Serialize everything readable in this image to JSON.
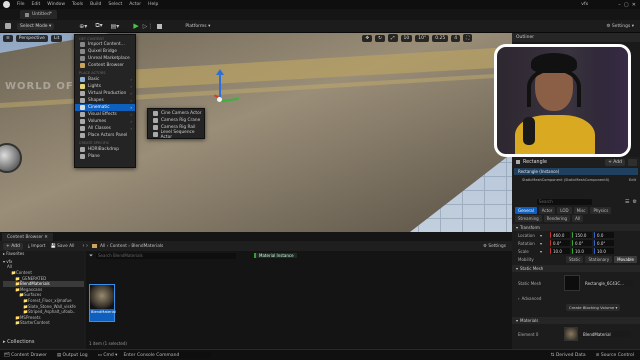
{
  "menubar": {
    "items": [
      "File",
      "Edit",
      "Window",
      "Tools",
      "Build",
      "Select",
      "Actor",
      "Help"
    ],
    "user": "vfx"
  },
  "tabs": {
    "project": "Untitled*"
  },
  "toolbar": {
    "select_mode": "Select Mode",
    "platforms": "Platforms",
    "settings": "Settings"
  },
  "viewport": {
    "perspective": "Perspective",
    "lit": "Lit",
    "watermark": "WORLD OF",
    "grid_value": "10",
    "angle_value": "10°",
    "scale_value": "0.25",
    "cam_speed": "4"
  },
  "add_menu": {
    "top_items": [
      "Import Content...",
      "Quixel Bridge",
      "Unreal Marketplace",
      "Content Browser"
    ],
    "header_place": "PLACE ACTORS",
    "place_items": [
      "Basic",
      "Lights",
      "Virtual Production",
      "Shapes",
      "Cinematic",
      "Visual Effects",
      "Volumes",
      "All Classes",
      "Place Actors Panel"
    ],
    "header_create": "CREATE SPECIFIC",
    "create_items": [
      "HDRIBackdrop",
      "Plane"
    ]
  },
  "cinematic_menu": {
    "items": [
      "Cine Camera Actor",
      "Camera Rig Crane",
      "Camera Rig Rail",
      "Level Sequence Actor"
    ]
  },
  "outliner": {
    "title": "Outliner"
  },
  "details": {
    "actor": "Rectangle",
    "add_label": "+ Add",
    "instance": "Rectangle (Instance)",
    "component": "StaticMeshComponent (StaticMeshComponent0)",
    "edit": "Edit",
    "search_placeholder": "Search",
    "tabs": [
      "General",
      "Actor",
      "LOD",
      "Misc",
      "Physics"
    ],
    "tabs2": [
      "Streaming",
      "Rendering",
      "All"
    ],
    "transform": "Transform",
    "location": {
      "label": "Location",
      "x": "460.0",
      "y": "150.0",
      "z": "0.0"
    },
    "rotation": {
      "label": "Rotation",
      "x": "0.0°",
      "y": "0.0°",
      "z": "0.0°"
    },
    "scale": {
      "label": "Scale",
      "x": "10.0",
      "y": "10.0",
      "z": "10.0"
    },
    "mobility": {
      "label": "Mobility",
      "options": [
        "Static",
        "Stationary",
        "Movable"
      ]
    },
    "static_mesh_section": "Static Mesh",
    "static_mesh_label": "Static Mesh",
    "static_mesh_value": "Rectangle_6C43C...",
    "advanced": "Advanced",
    "create_volume": "Create Blocking Volume",
    "materials_section": "Materials",
    "element0": "Element 0",
    "material_value": "BlendMaterial"
  },
  "content_browser": {
    "title": "Content Browser",
    "add": "+ Add",
    "import": "Import",
    "save_all": "Save All",
    "path": [
      "All",
      "Content",
      "BlendMaterials"
    ],
    "settings": "Settings",
    "favorites": "Favorites",
    "root": "vfx",
    "tree": [
      "All",
      "Content",
      "_GENERATED",
      "BlendMaterials",
      "Megascans",
      "Surfaces",
      "Forest_Floor_xljmafue",
      "Slate_Stone_Wall_viskfe",
      "Striped_Asphalt_ufoob..",
      "MSPresets",
      "StarterContent"
    ],
    "search_placeholder": "Search BlendMaterials",
    "filter_badge": "Material Instance",
    "asset_label": "BlendMaterial",
    "count": "1 item (1 selected)",
    "collections": "Collections"
  },
  "statusbar": {
    "content_drawer": "Content Drawer",
    "output_log": "Output Log",
    "cmd": "Cmd",
    "cmd_placeholder": "Enter Console Command",
    "derived_data": "Derived Data",
    "source_control": "Source Control"
  },
  "colors": {
    "accent": "#0f5fbf",
    "highlight_green": "#2e6b1e"
  }
}
